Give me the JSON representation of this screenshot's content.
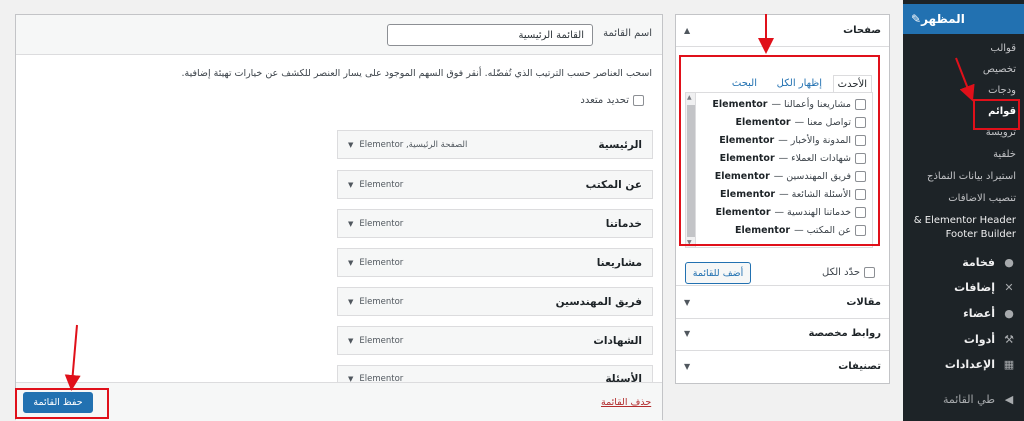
{
  "sidebar": {
    "appearance": "المظهر",
    "submenu": [
      {
        "label": "قوالب"
      },
      {
        "label": "تخصيص"
      },
      {
        "label": "ودجات"
      },
      {
        "label": "قوائم"
      },
      {
        "label": "ترويسة"
      },
      {
        "label": "خلفية"
      },
      {
        "label": "استيراد بيانات النماذج"
      },
      {
        "label": "تنصيب الاضافات"
      },
      {
        "label": "Elementor Header &"
      },
      {
        "label": "Footer Builder"
      }
    ],
    "top_items": [
      {
        "label": "فخامة",
        "icon": "paint-icon"
      },
      {
        "label": "إضافات",
        "icon": "plugin-icon"
      },
      {
        "label": "أعضاء",
        "icon": "users-icon"
      },
      {
        "label": "أدوات",
        "icon": "wrench-icon"
      },
      {
        "label": "الإعدادات",
        "icon": "settings-icon"
      },
      {
        "label": "طي القائمة",
        "icon": "collapse-icon"
      }
    ]
  },
  "accordion": {
    "pages_title": "صفحات",
    "tabs": {
      "latest": "الأحدث",
      "view_all": "إظهار الكل",
      "search": "البحث"
    },
    "pages": [
      {
        "label": "مشاريعنا وأعمالنا — ",
        "tag": "Elementor"
      },
      {
        "label": "تواصل معنا — ",
        "tag": "Elementor"
      },
      {
        "label": "المدونة والأخبار — ",
        "tag": "Elementor"
      },
      {
        "label": "شهادات العملاء — ",
        "tag": "Elementor"
      },
      {
        "label": "فريق المهندسين — ",
        "tag": "Elementor"
      },
      {
        "label": "الأسئلة الشائعة — ",
        "tag": "Elementor"
      },
      {
        "label": "خدماتنا الهندسية — ",
        "tag": "Elementor"
      },
      {
        "label": "عن المكتب — ",
        "tag": "Elementor"
      }
    ],
    "select_all": "حدّد الكل",
    "add_button": "أضف للقائمة",
    "sections": [
      {
        "title": "مقالات"
      },
      {
        "title": "روابط مخصصة"
      },
      {
        "title": "تصنيفات"
      }
    ]
  },
  "editor": {
    "menu_name_label": "اسم القائمة",
    "menu_name_value": "القائمة الرئيسية",
    "instructions": "اسحب العناصر حسب الترتيب الذي تُفضّله. أنقر فوق السهم الموجود على يسار العنصر للكشف عن خيارات تهيئة إضافية.",
    "bulk_select": "تحديد متعدد",
    "items": [
      {
        "title": "الرئيسية",
        "type": "الصفحة الرئيسية, Elementor"
      },
      {
        "title": "عن المكتب",
        "type": "Elementor"
      },
      {
        "title": "خدماتنا",
        "type": "Elementor"
      },
      {
        "title": "مشاريعنا",
        "type": "Elementor"
      },
      {
        "title": "فريق المهندسين",
        "type": "Elementor"
      },
      {
        "title": "الشهادات",
        "type": "Elementor"
      },
      {
        "title": "الأسئلة",
        "type": "Elementor"
      }
    ],
    "save_button": "حفظ القائمة",
    "delete_link": "حذف القائمة"
  },
  "colors": {
    "accent": "#2271b1",
    "highlight": "#e0101a",
    "sidebar": "#1d2327"
  }
}
